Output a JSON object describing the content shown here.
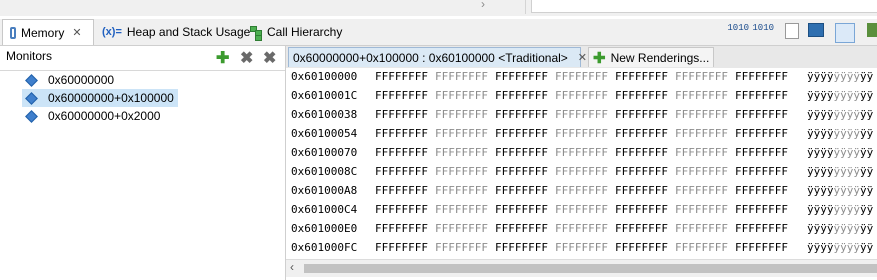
{
  "tabs": {
    "memory": "Memory",
    "heap": "Heap and Stack Usage",
    "heap_prefix": "(x)=",
    "call": "Call Hierarchy"
  },
  "toolbar": {
    "binary1": "1010",
    "binary2": "1010"
  },
  "monitors": {
    "title": "Monitors",
    "items": [
      "0x60000000",
      "0x60000000+0x100000",
      "0x60000000+0x2000"
    ]
  },
  "rendering": {
    "tab_label": "0x60000000+0x100000 : 0x60100000 <Traditional>",
    "new_label": "New Renderings...",
    "rows": [
      {
        "addr": "0x60100000",
        "text1": "ÿÿÿÿ",
        "text2": "ÿÿÿÿ",
        "text3": "ÿÿ"
      },
      {
        "addr": "0x6010001C",
        "text1": "ÿÿÿÿ",
        "text2": "ÿÿÿÿ",
        "text3": "ÿÿ"
      },
      {
        "addr": "0x60100038",
        "text1": "ÿÿÿÿ",
        "text2": "ÿÿÿÿ",
        "text3": "ÿÿ"
      },
      {
        "addr": "0x60100054",
        "text1": "ÿÿÿÿ",
        "text2": "ÿÿÿÿ",
        "text3": "ÿÿ"
      },
      {
        "addr": "0x60100070",
        "text1": "ÿÿÿÿ",
        "text2": "ÿÿÿÿ",
        "text3": "ÿÿ"
      },
      {
        "addr": "0x6010008C",
        "text1": "ÿÿÿÿ",
        "text2": "ÿÿÿÿ",
        "text3": "ÿÿ"
      },
      {
        "addr": "0x601000A8",
        "text1": "ÿÿÿÿ",
        "text2": "ÿÿÿÿ",
        "text3": "ÿÿ"
      },
      {
        "addr": "0x601000C4",
        "text1": "ÿÿÿÿ",
        "text2": "ÿÿÿÿ",
        "text3": "ÿÿ"
      },
      {
        "addr": "0x601000E0",
        "text1": "ÿÿÿÿ",
        "text2": "ÿÿÿÿ",
        "text3": "ÿÿ"
      },
      {
        "addr": "0x601000FC",
        "text1": "ÿÿÿÿ",
        "text2": "ÿÿÿÿ",
        "text3": "ÿÿ"
      }
    ],
    "cell": "FFFFFFFF"
  }
}
